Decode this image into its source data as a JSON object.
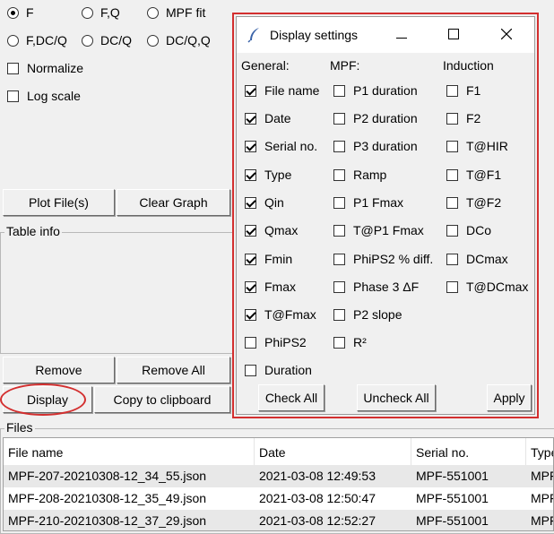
{
  "plot_mode": {
    "options": [
      {
        "label": "F",
        "selected": true
      },
      {
        "label": "F,Q",
        "selected": false
      },
      {
        "label": "MPF fit",
        "selected": false
      },
      {
        "label": "F,DC/Q",
        "selected": false
      },
      {
        "label": "DC/Q",
        "selected": false
      },
      {
        "label": "DC/Q,Q",
        "selected": false
      }
    ],
    "normalize_label": "Normalize",
    "log_scale_label": "Log scale"
  },
  "buttons": {
    "plot_files": "Plot File(s)",
    "clear_graph": "Clear Graph",
    "remove": "Remove",
    "remove_all": "Remove All",
    "display": "Display",
    "copy_clipboard": "Copy to clipboard"
  },
  "table_info": {
    "label": "Table info"
  },
  "dialog": {
    "title": "Display settings",
    "headers": {
      "general": "General:",
      "mpf": "MPF:",
      "induction": "Induction"
    },
    "general": [
      {
        "label": "File name",
        "checked": true
      },
      {
        "label": "Date",
        "checked": true
      },
      {
        "label": "Serial no.",
        "checked": true
      },
      {
        "label": "Type",
        "checked": true
      },
      {
        "label": "Qin",
        "checked": true
      },
      {
        "label": "Qmax",
        "checked": true
      },
      {
        "label": "Fmin",
        "checked": true
      },
      {
        "label": "Fmax",
        "checked": true
      },
      {
        "label": "T@Fmax",
        "checked": true
      },
      {
        "label": "PhiPS2",
        "checked": false
      },
      {
        "label": "Duration",
        "checked": false
      }
    ],
    "mpf": [
      {
        "label": "P1 duration",
        "checked": false
      },
      {
        "label": "P2 duration",
        "checked": false
      },
      {
        "label": "P3 duration",
        "checked": false
      },
      {
        "label": "Ramp",
        "checked": false
      },
      {
        "label": "P1 Fmax",
        "checked": false
      },
      {
        "label": "T@P1 Fmax",
        "checked": false
      },
      {
        "label": "PhiPS2 % diff.",
        "checked": false
      },
      {
        "label": "Phase 3 ΔF",
        "checked": false
      },
      {
        "label": "P2 slope",
        "checked": false
      },
      {
        "label": "R²",
        "checked": false
      }
    ],
    "induction": [
      {
        "label": "F1",
        "checked": false
      },
      {
        "label": "F2",
        "checked": false
      },
      {
        "label": "T@HIR",
        "checked": false
      },
      {
        "label": "T@F1",
        "checked": false
      },
      {
        "label": "T@F2",
        "checked": false
      },
      {
        "label": "DCo",
        "checked": false
      },
      {
        "label": "DCmax",
        "checked": false
      },
      {
        "label": "T@DCmax",
        "checked": false
      }
    ],
    "check_all": "Check All",
    "uncheck_all": "Uncheck All",
    "apply": "Apply"
  },
  "files": {
    "label": "Files",
    "columns": [
      "File name",
      "Date",
      "Serial no.",
      "Type"
    ],
    "rows": [
      [
        "MPF-207-20210308-12_34_55.json",
        "2021-03-08 12:49:53",
        "MPF-551001",
        "MPF"
      ],
      [
        "MPF-208-20210308-12_35_49.json",
        "2021-03-08 12:50:47",
        "MPF-551001",
        "MPF"
      ],
      [
        "MPF-210-20210308-12_37_29.json",
        "2021-03-08 12:52:27",
        "MPF-551001",
        "MPF"
      ]
    ]
  },
  "colors": {
    "highlight": "#d32f2f",
    "row_alt": "#e8e8e8"
  }
}
